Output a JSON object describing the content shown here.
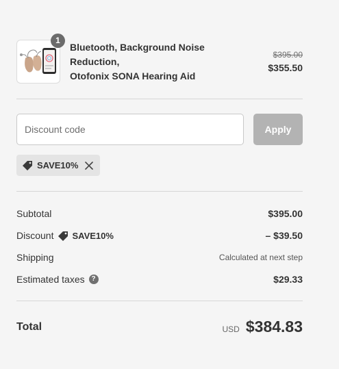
{
  "product": {
    "name_line1": "Bluetooth, Background Noise Reduction,",
    "name_line2": "Otofonix SONA Hearing Aid",
    "quantity": "1",
    "original_price": "$395.00",
    "sale_price": "$355.50",
    "image_icon": "hearing-aid-product-image"
  },
  "discount": {
    "placeholder": "Discount code",
    "apply_label": "Apply",
    "applied_code": "SAVE10%"
  },
  "summary": {
    "subtotal_label": "Subtotal",
    "subtotal_value": "$395.00",
    "discount_label": "Discount",
    "discount_code": "SAVE10%",
    "discount_value": "– $39.50",
    "shipping_label": "Shipping",
    "shipping_value": "Calculated at next step",
    "taxes_label": "Estimated taxes",
    "taxes_help": "?",
    "taxes_value": "$29.33"
  },
  "total": {
    "label": "Total",
    "currency": "USD",
    "amount": "$384.83"
  },
  "colors": {
    "background": "#f5f5f5",
    "apply_disabled": "#b3b3b3",
    "chip_bg": "#e4e4e4",
    "text": "#333333"
  }
}
